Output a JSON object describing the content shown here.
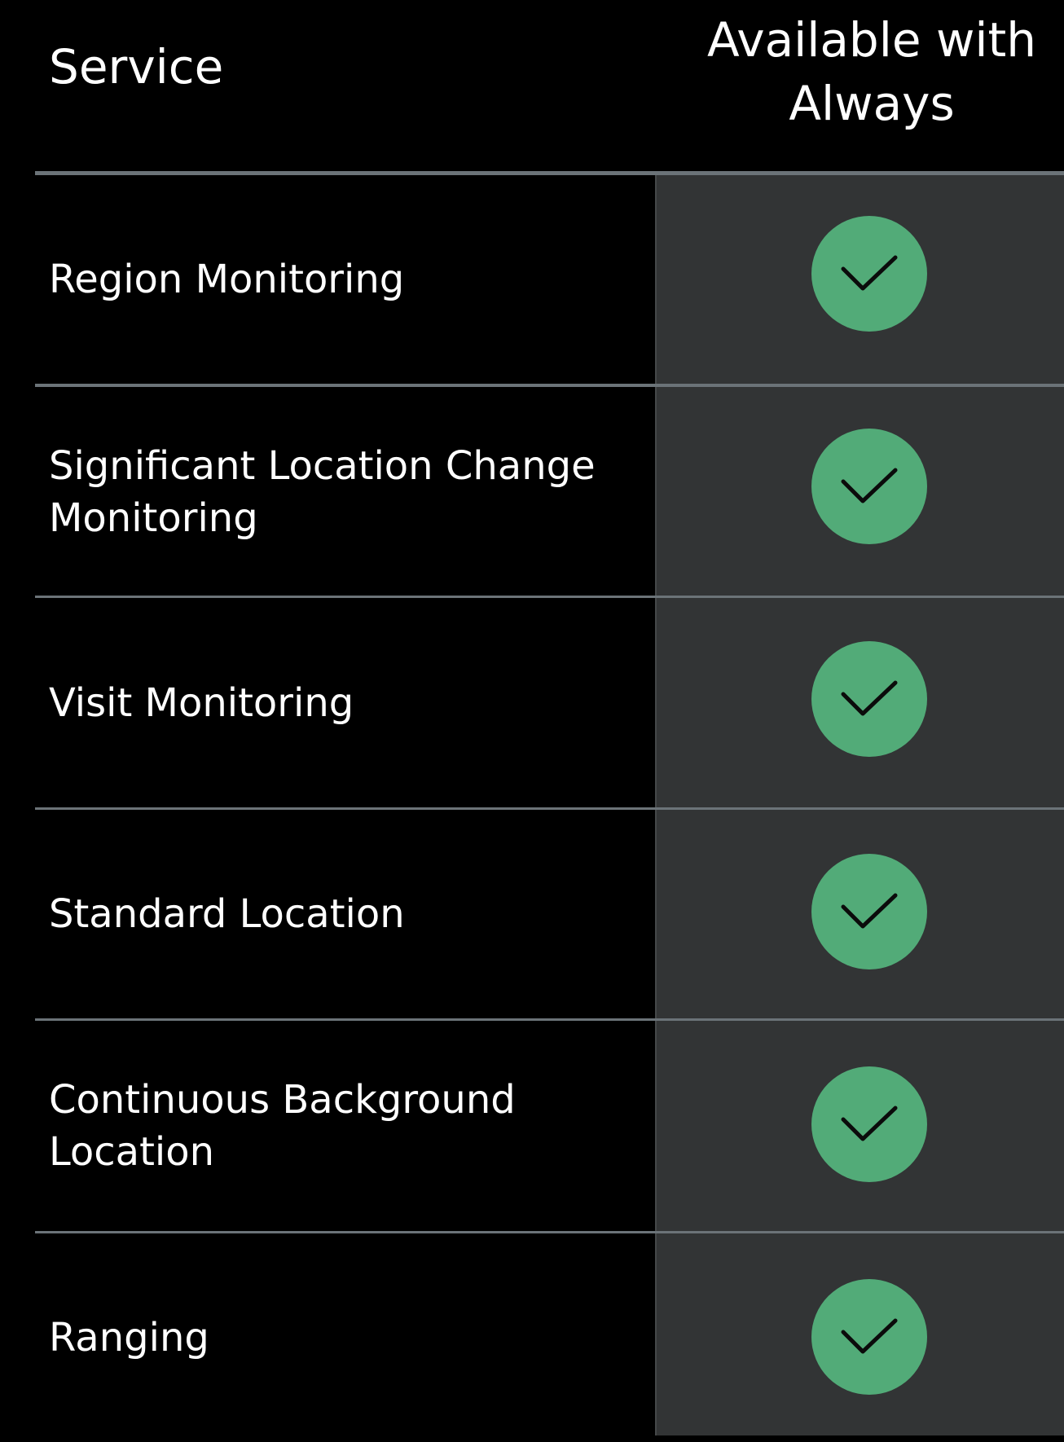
{
  "header": {
    "service_label": "Service",
    "always_label": "Available with Always"
  },
  "rows": [
    {
      "label": "Region Monitoring",
      "available": true
    },
    {
      "label": "Significant Location Change Monitoring",
      "available": true
    },
    {
      "label": "Visit Monitoring",
      "available": true
    },
    {
      "label": "Standard Location",
      "available": true
    },
    {
      "label": "Continuous Background Location",
      "available": true
    },
    {
      "label": "Ranging",
      "available": true
    }
  ],
  "icons": {
    "check": "check-icon"
  },
  "colors": {
    "background": "#000000",
    "shaded_column": "#323435",
    "divider": "#6b7378",
    "check_fill": "#52ab78",
    "check_stroke": "#0b0b0b",
    "text": "#ffffff"
  }
}
